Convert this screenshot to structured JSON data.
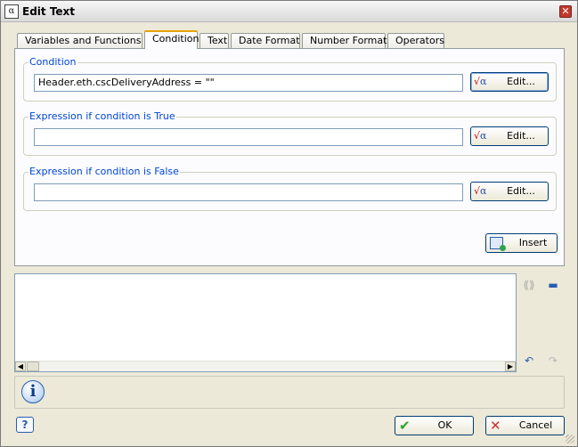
{
  "window": {
    "title": "Edit Text",
    "close_glyph": "✕",
    "app_icon_glyph": "α"
  },
  "tabs": [
    {
      "label": "Variables and Functions"
    },
    {
      "label": "Condition"
    },
    {
      "label": "Text"
    },
    {
      "label": "Date Format"
    },
    {
      "label": "Number Format"
    },
    {
      "label": "Operators"
    }
  ],
  "active_tab": "Condition",
  "condition": {
    "label": "Condition",
    "value": "Header.eth.cscDeliveryAddress = \"\"",
    "edit_label": "Edit..."
  },
  "true_expr": {
    "label": "Expression if condition is True",
    "value": "",
    "edit_label": "Edit..."
  },
  "false_expr": {
    "label": "Expression if condition is False",
    "value": "",
    "edit_label": "Edit..."
  },
  "insert_label": "Insert",
  "editor": {
    "value": ""
  },
  "footer": {
    "help_glyph": "?",
    "ok_label": "OK",
    "cancel_label": "Cancel"
  },
  "icons": {
    "edit_formula": "sqrt-alpha-icon",
    "insert": "insert-icon",
    "info": "info-icon",
    "undo": "undo-icon",
    "redo": "redo-icon",
    "validate": "validate-icon",
    "save": "save-icon"
  },
  "colors": {
    "group_label": "#0046d5",
    "active_tab_accent": "#e8a202",
    "window_bg": "#ece9d8"
  }
}
